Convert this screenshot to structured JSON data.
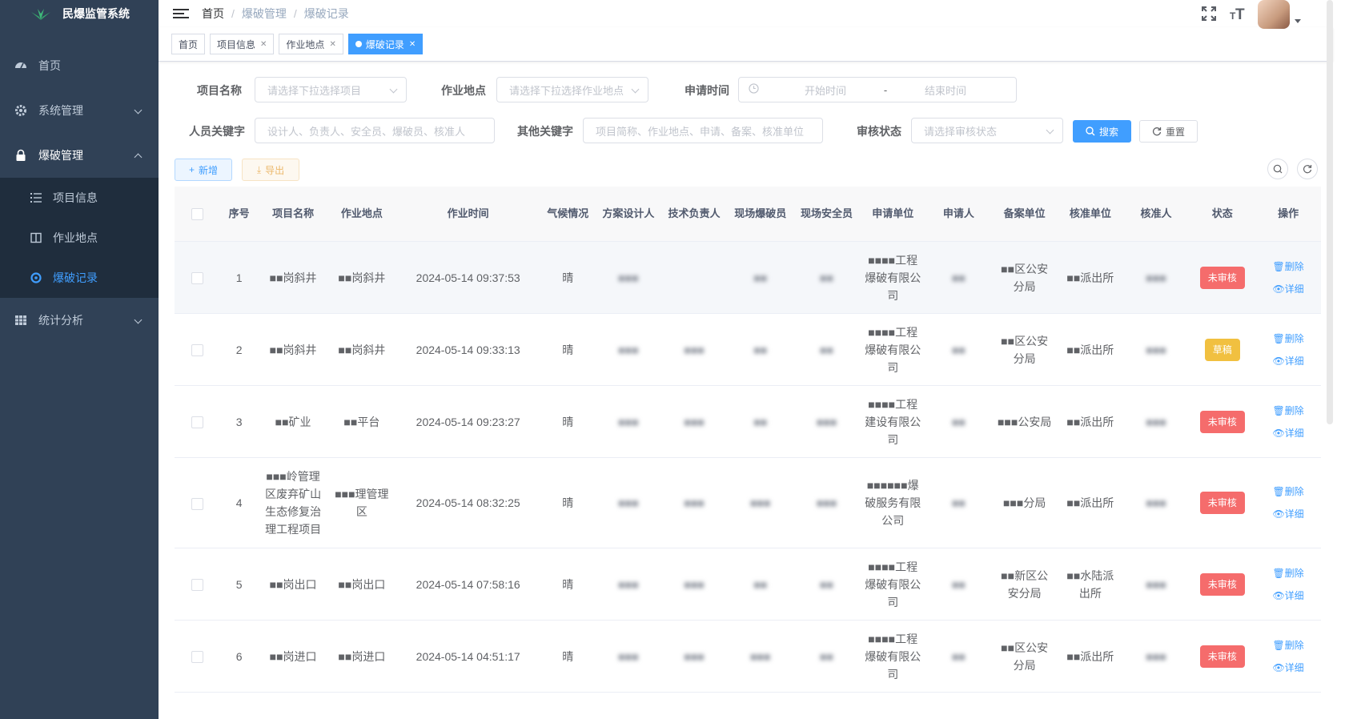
{
  "app": {
    "title": "民爆监管系统"
  },
  "sidebar": {
    "items": [
      {
        "label": "首页",
        "icon": "dashboard-icon"
      },
      {
        "label": "系统管理",
        "icon": "gear-icon"
      },
      {
        "label": "爆破管理",
        "icon": "lock-icon"
      },
      {
        "label": "统计分析",
        "icon": "table-icon"
      }
    ],
    "sub": [
      {
        "label": "项目信息",
        "icon": "list-icon"
      },
      {
        "label": "作业地点",
        "icon": "columns-icon"
      },
      {
        "label": "爆破记录",
        "icon": "target-icon"
      }
    ]
  },
  "breadcrumb": [
    "首页",
    "爆破管理",
    "爆破记录"
  ],
  "tags": [
    {
      "label": "首页"
    },
    {
      "label": "项目信息"
    },
    {
      "label": "作业地点"
    },
    {
      "label": "爆破记录"
    }
  ],
  "form": {
    "project_label": "项目名称",
    "project_placeholder": "请选择下拉选择项目",
    "site_label": "作业地点",
    "site_placeholder": "请选择下拉选择作业地点",
    "time_label": "申请时间",
    "start_placeholder": "开始时间",
    "range_sep": "-",
    "end_placeholder": "结束时间",
    "person_label": "人员关键字",
    "person_placeholder": "设计人、负责人、安全员、爆破员、核准人",
    "other_label": "其他关键字",
    "other_placeholder": "项目简称、作业地点、申请、备案、核准单位",
    "status_label": "审核状态",
    "status_placeholder": "请选择审核状态",
    "search_btn": "搜索",
    "reset_btn": "重置"
  },
  "toolbar": {
    "add_btn": "新增",
    "export_btn": "导出"
  },
  "table": {
    "headers": [
      "序号",
      "项目名称",
      "作业地点",
      "作业时间",
      "气候情况",
      "方案设计人",
      "技术负责人",
      "现场爆破员",
      "现场安全员",
      "申请单位",
      "申请人",
      "备案单位",
      "核准单位",
      "核准人",
      "状态",
      "操作"
    ],
    "delete_label": "删除",
    "detail_label": "详细",
    "rows": [
      {
        "no": "1",
        "project": "■■岗斜井",
        "site": "■■岗斜井",
        "time": "2024-05-14 09:37:53",
        "weather": "晴",
        "designer": "■■■",
        "tech": "",
        "blaster": "■■",
        "safety": "■■",
        "unit": "■■■■工程爆破有限公司",
        "applicant": "■■",
        "record": "■■区公安分局",
        "approve": "■■派出所",
        "approver": "■■■",
        "status": "未审核",
        "status_color": "red"
      },
      {
        "no": "2",
        "project": "■■岗斜井",
        "site": "■■岗斜井",
        "time": "2024-05-14 09:33:13",
        "weather": "晴",
        "designer": "■■■",
        "tech": "■■■",
        "blaster": "■■",
        "safety": "■■",
        "unit": "■■■■工程爆破有限公司",
        "applicant": "■■",
        "record": "■■区公安分局",
        "approve": "■■派出所",
        "approver": "■■■",
        "status": "草稿",
        "status_color": "yellow"
      },
      {
        "no": "3",
        "project": "■■矿业",
        "site": "■■平台",
        "time": "2024-05-14 09:23:27",
        "weather": "晴",
        "designer": "■■■",
        "tech": "■■■",
        "blaster": "■■",
        "safety": "■■■",
        "unit": "■■■■工程建设有限公司",
        "applicant": "■■",
        "record": "■■■公安局",
        "approve": "■■派出所",
        "approver": "■■■",
        "status": "未审核",
        "status_color": "red"
      },
      {
        "no": "4",
        "project": "■■■岭管理区废弃矿山生态修复治理工程项目",
        "site": "■■■理管理区",
        "time": "2024-05-14 08:32:25",
        "weather": "晴",
        "designer": "■■■",
        "tech": "■■■",
        "blaster": "■■■",
        "safety": "■■■",
        "unit": "■■■■■■爆破服务有限公司",
        "applicant": "■■",
        "record": "■■■分局",
        "approve": "■■派出所",
        "approver": "■■■",
        "status": "未审核",
        "status_color": "red"
      },
      {
        "no": "5",
        "project": "■■岗出口",
        "site": "■■岗出口",
        "time": "2024-05-14 07:58:16",
        "weather": "晴",
        "designer": "■■■",
        "tech": "■■■",
        "blaster": "■■",
        "safety": "■■",
        "unit": "■■■■工程爆破有限公司",
        "applicant": "■■",
        "record": "■■新区公安分局",
        "approve": "■■水陆派出所",
        "approver": "■■■",
        "status": "未审核",
        "status_color": "red"
      },
      {
        "no": "6",
        "project": "■■岗进口",
        "site": "■■岗进口",
        "time": "2024-05-14 04:51:17",
        "weather": "晴",
        "designer": "■■■",
        "tech": "■■■",
        "blaster": "■■■",
        "safety": "■■",
        "unit": "■■■■工程爆破有限公司",
        "applicant": "■■",
        "record": "■■区公安分局",
        "approve": "■■派出所",
        "approver": "■■■",
        "status": "未审核",
        "status_color": "red"
      }
    ]
  },
  "colors": {
    "sidebar_bg": "#304156",
    "accent": "#409eff",
    "danger": "#f56c6c",
    "warning": "#f1c040"
  }
}
